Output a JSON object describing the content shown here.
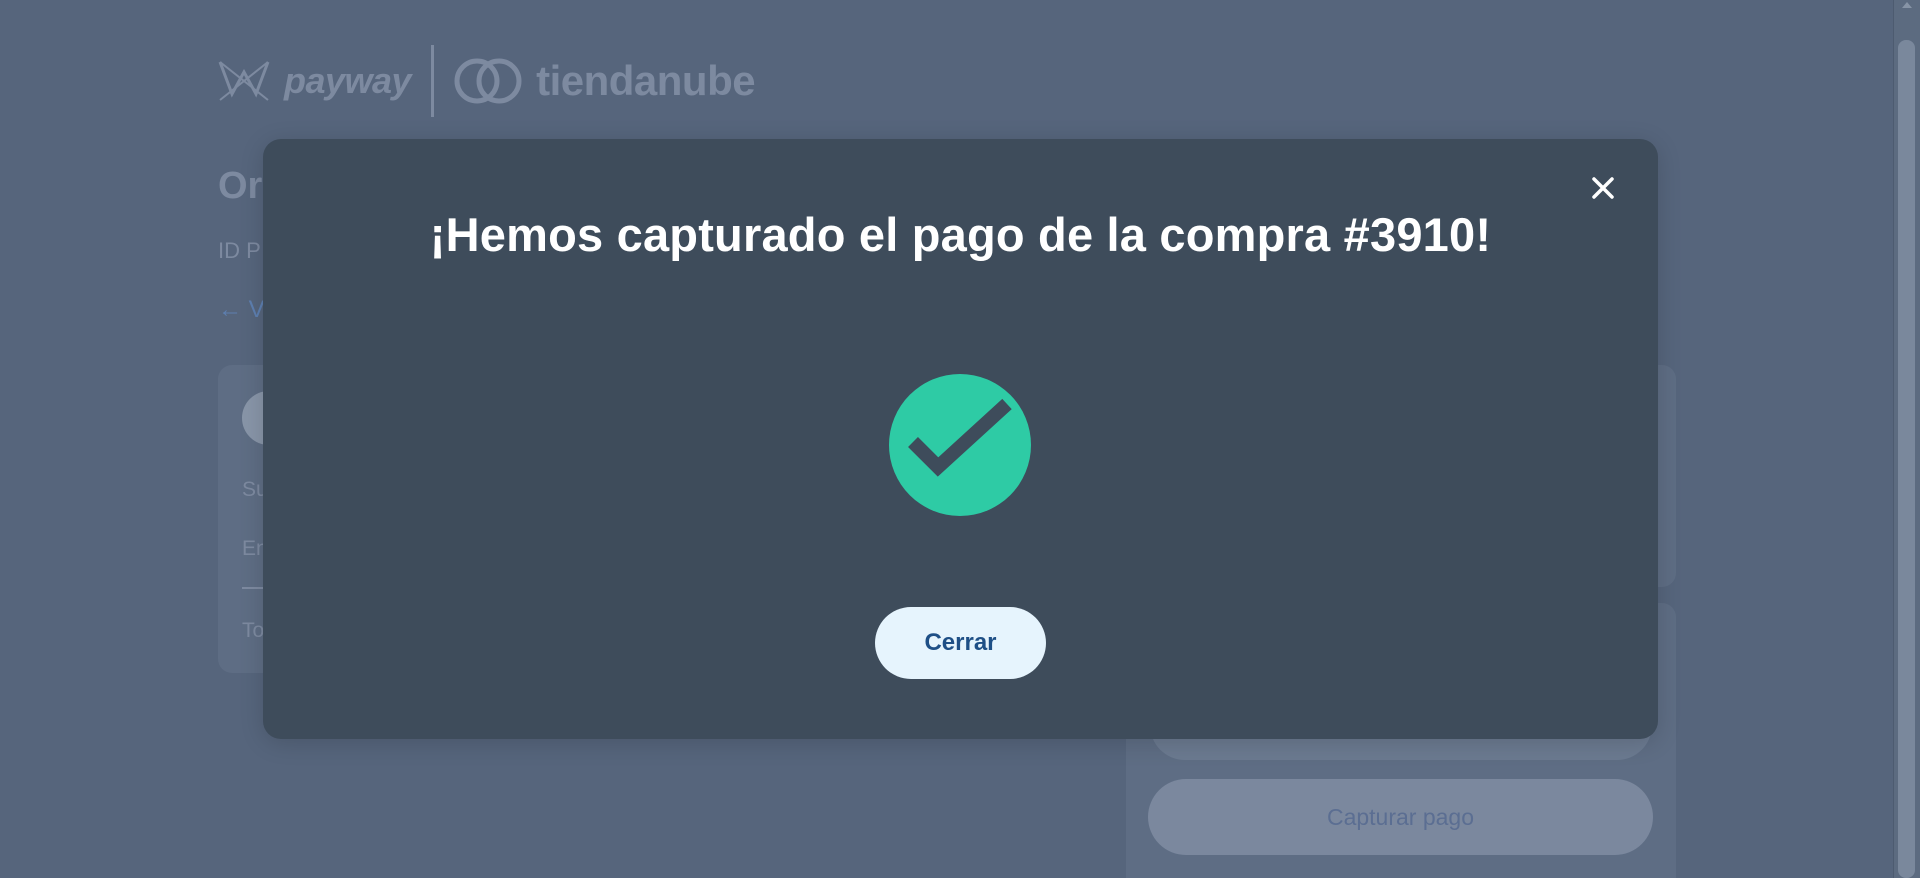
{
  "brand": {
    "payway": "payway",
    "tiendanube": "tiendanube"
  },
  "background": {
    "title": "Or",
    "subtitle": "ID P",
    "back_link": "← V",
    "card_rows": [
      "Su",
      "En",
      "To"
    ],
    "capture_button": "Capturar pago"
  },
  "modal": {
    "title": "¡Hemos capturado el pago de la compra #3910!",
    "close_icon": "close-icon",
    "status_icon": "check-circle-icon",
    "status_color": "#2ecba5",
    "button_label": "Cerrar"
  }
}
